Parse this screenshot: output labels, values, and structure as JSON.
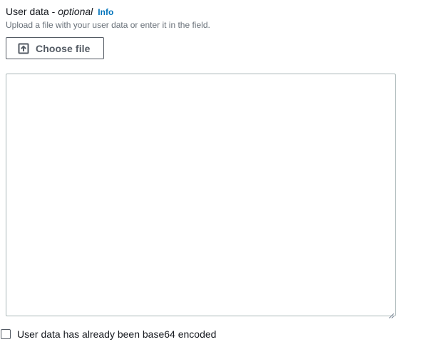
{
  "user_data": {
    "label": "User data -",
    "optional_label": "optional",
    "info_link": "Info",
    "description": "Upload a file with your user data or enter it in the field.",
    "choose_file_button": {
      "label": "Choose file",
      "icon": "upload-icon"
    },
    "textarea": {
      "value": "",
      "placeholder": ""
    },
    "base64_checkbox": {
      "label": "User data has already been base64 encoded",
      "checked": false
    }
  },
  "colors": {
    "text": "#16191f",
    "description": "#687078",
    "link": "#0073bb",
    "button_border": "#545b64",
    "textarea_border": "#aab7b8"
  }
}
